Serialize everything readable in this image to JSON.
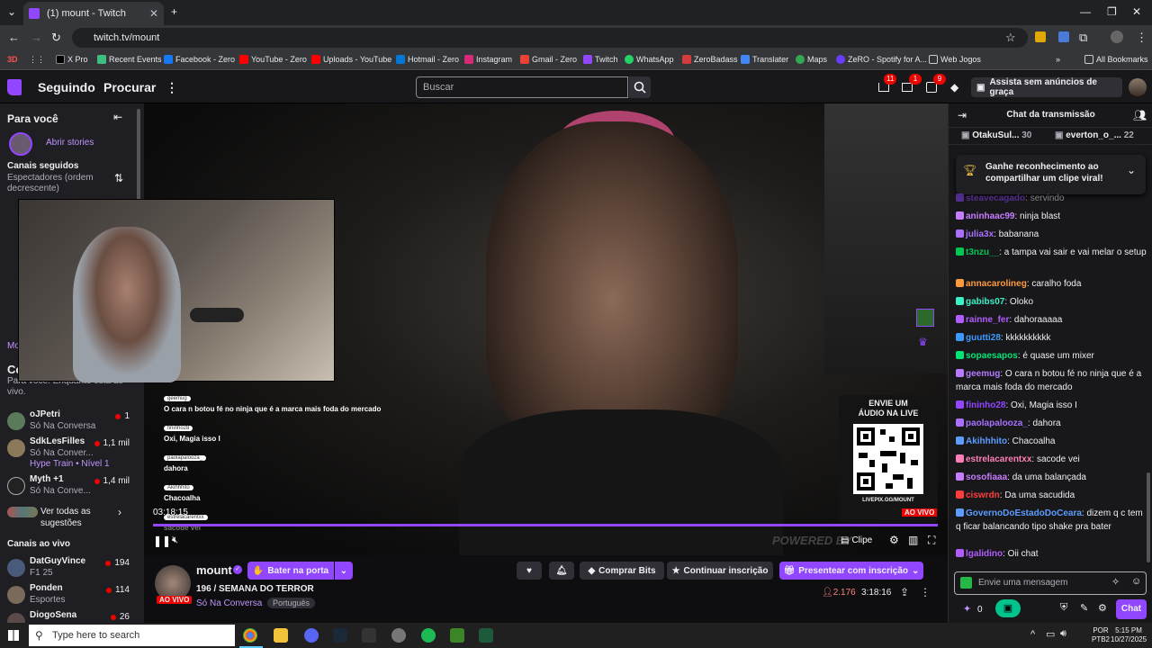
{
  "browser": {
    "tab_title": "(1) mount - Twitch",
    "url": "twitch.tv/mount",
    "bookmarks": [
      "X Pro",
      "Recent Events",
      "Facebook - Zero",
      "YouTube - Zero",
      "Uploads - YouTube",
      "Hotmail - Zero",
      "Instagram",
      "Gmail - Zero",
      "Twitch",
      "WhatsApp",
      "ZeroBadass",
      "Translater",
      "Maps",
      "ZeRO - Spotify for A...",
      "Web Jogos"
    ],
    "bookmarks_3d": "3D",
    "all_bookmarks": "All Bookmarks"
  },
  "nav": {
    "following": "Seguindo",
    "browse": "Procurar",
    "search_placeholder": "Buscar",
    "badge_inbox": "11",
    "badge_whispers": "1",
    "badge_notifications": "9",
    "turbo": "Assista sem anúncios de graça"
  },
  "sidebar": {
    "for_you": "Para você",
    "stories": "Abrir stories",
    "followed_title": "Canais seguidos",
    "sort": "Espectadores (ordem decrescente)",
    "partial_title": "Co",
    "partial_text": "Para você. Enquanto está ao vivo.",
    "partial_mo": "Mo",
    "recommended": [
      {
        "name": "oJPetri",
        "game": "Só Na Conversa",
        "viewers": "1"
      },
      {
        "name": "SdkLesFilles",
        "game": "Só Na Conver...",
        "viewers": "1,1 mil",
        "extra": "Hype Train • Nível 1"
      },
      {
        "name": "Myth +1",
        "game": "Só Na Conve...",
        "viewers": "1,4 mil"
      }
    ],
    "see_all": "Ver todas as sugestões",
    "live_title": "Canais ao vivo",
    "live": [
      {
        "name": "DatGuyVince",
        "game": "F1 25",
        "viewers": "194"
      },
      {
        "name": "Ponden",
        "game": "Esportes",
        "viewers": "114"
      },
      {
        "name": "DiogoSena",
        "game": "",
        "viewers": "26"
      }
    ]
  },
  "video": {
    "time": "03:18:15",
    "overlay": [
      {
        "user": "geemug",
        "msg": "O cara n botou fé no ninja que é a marca mais foda do mercado"
      },
      {
        "user": "fininho28",
        "msg": "Oxi, Magia isso I"
      },
      {
        "user": "paolapalooza_",
        "msg": "dahora"
      },
      {
        "user": "Akihhhito",
        "msg": "Chacoalha"
      },
      {
        "user": "estrelacarentxx",
        "msg": "sacode vei"
      }
    ],
    "qr_title1": "ENVIE UM",
    "qr_title2": "ÁUDIO NA LIVE",
    "qr_link": "LIVEPIX.GG/MOUNT",
    "live_badge": "AO VIVO",
    "powered": "POWERED BY",
    "clip": "Clipe"
  },
  "channel": {
    "name": "mount",
    "knock": "Bater na porta",
    "title": "196 / SEMANA DO TERROR",
    "live": "AO VIVO",
    "category": "Só Na Conversa",
    "tag": "Português",
    "buy_bits": "Comprar Bits",
    "continue_sub": "Continuar inscrição",
    "gift_sub": "Presentear com inscrição",
    "viewers": "2.176",
    "uptime": "3:18:16"
  },
  "chat": {
    "title": "Chat da transmissão",
    "top_gifters": [
      {
        "name": "OtakuSul...",
        "count": "30"
      },
      {
        "name": "everton_o_...",
        "count": "22"
      }
    ],
    "banner": "Ganhe reconhecimento ao compartilhar um clipe viral!",
    "messages": [
      {
        "user": "steavecagado",
        "text": "servindo",
        "color": "#9146ff"
      },
      {
        "user": "aninhaac99",
        "text": "ninja blast",
        "color": "#c77dff"
      },
      {
        "user": "julia3x",
        "text": "babanana",
        "color": "#a970ff"
      },
      {
        "user": "t3nzu__",
        "text": "a tampa vai sair e vai melar o setup",
        "color": "#00c853"
      },
      {
        "user": "annacarolineg",
        "text": "caralho foda",
        "color": "#ff9a3c"
      },
      {
        "user": "gabibs07",
        "text": "Oloko",
        "color": "#3cf0c8"
      },
      {
        "user": "rainne_fer",
        "text": "dahoraaaaa",
        "color": "#b05cff"
      },
      {
        "user": "guutti28",
        "text": "kkkkkkkkkk",
        "color": "#3c9aff"
      },
      {
        "user": "sopaesapos",
        "text": "é quase um mixer",
        "color": "#00e676"
      },
      {
        "user": "geemug",
        "text": "O cara n botou fé no ninja que é a marca mais foda do mercado",
        "color": "#b57aff"
      },
      {
        "user": "fininho28",
        "text": "Oxi, Magia isso I",
        "color": "#9146ff"
      },
      {
        "user": "paolapalooza_",
        "text": "dahora",
        "color": "#a970ff"
      },
      {
        "user": "Akihhhito",
        "text": "Chacoalha",
        "color": "#5c9dff"
      },
      {
        "user": "estrelacarentxx",
        "text": "sacode vei",
        "color": "#ff7eb6"
      },
      {
        "user": "sosofiaaa",
        "text": "da uma balançada",
        "color": "#c77dff"
      },
      {
        "user": "ciswrdn",
        "text": "Da uma sacudida",
        "color": "#ff3c3c"
      },
      {
        "user": "GovernoDoEstadoDoCeara",
        "text": "dizem q c tem q ficar balancando tipo shake pra bater",
        "color": "#5c9dff"
      },
      {
        "user": "lgalidino",
        "text": "Oii chat",
        "color": "#b05cff"
      }
    ],
    "input_placeholder": "Envie uma mensagem",
    "points": "0",
    "send": "Chat"
  },
  "taskbar": {
    "search": "Type here to search",
    "lang1": "POR",
    "lang2": "PTB2",
    "time": "5:15 PM",
    "date": "10/27/2025"
  },
  "colors": {
    "accent": "#9146ff",
    "live": "#eb0400"
  }
}
